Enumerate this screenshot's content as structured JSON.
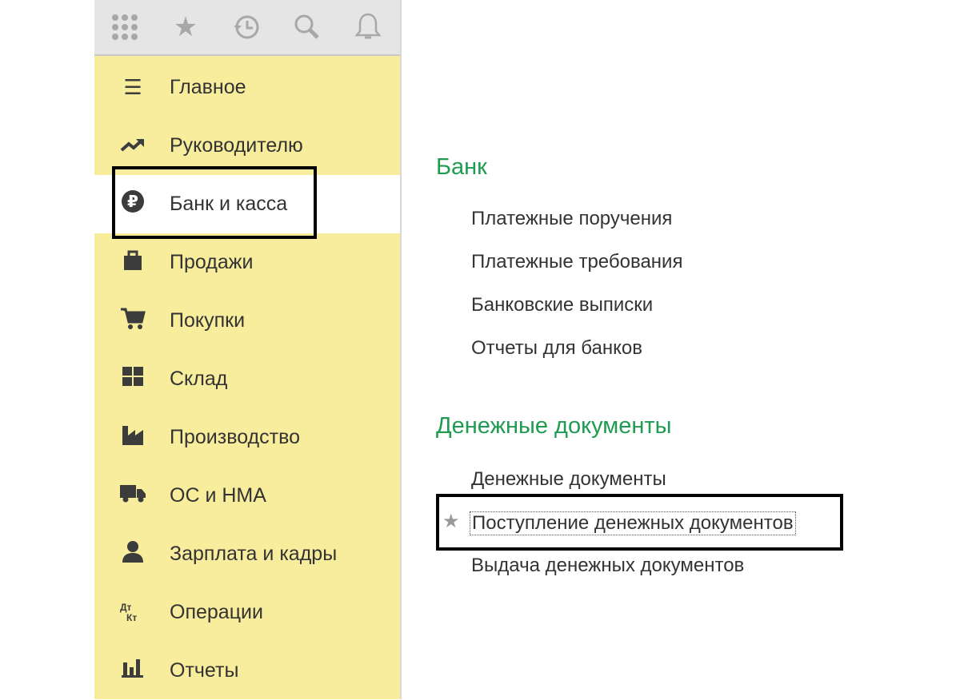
{
  "topbar": {
    "icons": [
      "apps-icon",
      "star-icon",
      "history-icon",
      "search-icon",
      "bell-icon"
    ]
  },
  "sidebar": {
    "items": [
      {
        "label": "Главное",
        "icon": "menu-icon"
      },
      {
        "label": "Руководителю",
        "icon": "trend-icon"
      },
      {
        "label": "Банк и касса",
        "icon": "ruble-icon",
        "selected": true
      },
      {
        "label": "Продажи",
        "icon": "bag-icon"
      },
      {
        "label": "Покупки",
        "icon": "cart-icon"
      },
      {
        "label": "Склад",
        "icon": "warehouse-icon"
      },
      {
        "label": "Производство",
        "icon": "factory-icon"
      },
      {
        "label": "ОС и НМА",
        "icon": "truck-icon"
      },
      {
        "label": "Зарплата и кадры",
        "icon": "person-icon"
      },
      {
        "label": "Операции",
        "icon": "dt-kt-icon",
        "glyph_top": "Дт",
        "glyph_bottom": "Кт"
      },
      {
        "label": "Отчеты",
        "icon": "bar-chart-icon"
      }
    ]
  },
  "main": {
    "sections": [
      {
        "title": "Банк",
        "links": [
          "Платежные поручения",
          "Платежные требования",
          "Банковские выписки",
          "Отчеты для банков"
        ]
      },
      {
        "title": "Денежные документы",
        "links": [
          "Денежные документы",
          "Поступление денежных документов",
          "Выдача денежных документов"
        ]
      }
    ]
  },
  "colors": {
    "accent": "#1f9b52",
    "sidebar": "#f8ec9d"
  }
}
